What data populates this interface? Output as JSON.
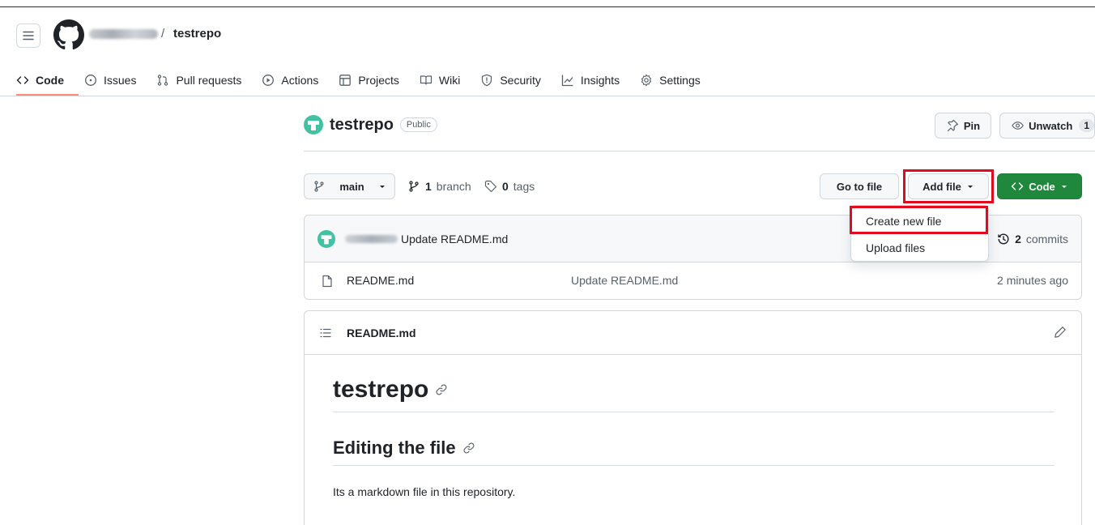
{
  "header": {
    "breadcrumb_sep": "/",
    "repo_crumb": "testrepo"
  },
  "tabs": [
    {
      "label": "Code",
      "icon": "code-icon"
    },
    {
      "label": "Issues",
      "icon": "issue-icon"
    },
    {
      "label": "Pull requests",
      "icon": "pull-request-icon"
    },
    {
      "label": "Actions",
      "icon": "play-icon"
    },
    {
      "label": "Projects",
      "icon": "table-icon"
    },
    {
      "label": "Wiki",
      "icon": "book-icon"
    },
    {
      "label": "Security",
      "icon": "shield-icon"
    },
    {
      "label": "Insights",
      "icon": "graph-icon"
    },
    {
      "label": "Settings",
      "icon": "gear-icon"
    }
  ],
  "repo": {
    "name": "testrepo",
    "visibility": "Public",
    "pin_label": "Pin",
    "unwatch_label": "Unwatch",
    "watch_count": "1"
  },
  "branch_bar": {
    "current_branch": "main",
    "branch_count": "1",
    "branch_word": "branch",
    "tag_count": "0",
    "tag_word": "tags",
    "go_to_file": "Go to file",
    "add_file": "Add file",
    "code": "Code"
  },
  "add_file_menu": {
    "items": [
      "Create new file",
      "Upload files"
    ]
  },
  "latest_commit": {
    "message": "Update README.md",
    "commit_count": "2",
    "commit_word": "commits"
  },
  "files": [
    {
      "name": "README.md",
      "commit_message": "Update README.md",
      "age": "2 minutes ago"
    }
  ],
  "readme": {
    "file_name": "README.md",
    "h1": "testrepo",
    "h2": "Editing the file",
    "paragraph": "Its a markdown file in this repository."
  },
  "colors": {
    "primary_button": "#1f883d",
    "active_tab_underline": "#fd8c73",
    "annotation_box": "#e00b1c"
  }
}
